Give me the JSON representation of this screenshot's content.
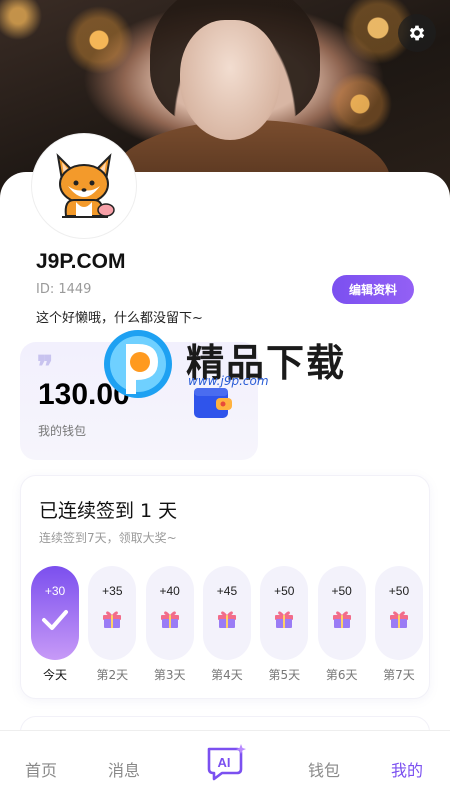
{
  "profile": {
    "username": "J9P.COM",
    "id_text": "ID: 1449",
    "bio": "这个好懒哦，什么都没留下~",
    "edit_label": "编辑资料"
  },
  "wallet": {
    "amount": "130.00",
    "label": "我的钱包"
  },
  "watermark": {
    "text": "精品下载",
    "url": "www.j9p.com"
  },
  "signin": {
    "title": "已连续签到 1 天",
    "subtitle": "连续签到7天，领取大奖~",
    "days": [
      {
        "points": "+30",
        "label": "今天",
        "checked": true
      },
      {
        "points": "+35",
        "label": "第2天",
        "checked": false
      },
      {
        "points": "+40",
        "label": "第3天",
        "checked": false
      },
      {
        "points": "+45",
        "label": "第4天",
        "checked": false
      },
      {
        "points": "+50",
        "label": "第5天",
        "checked": false
      },
      {
        "points": "+50",
        "label": "第6天",
        "checked": false
      },
      {
        "points": "+50",
        "label": "第7天",
        "checked": false
      }
    ]
  },
  "tabs": {
    "home": "首页",
    "messages": "消息",
    "ai": "AI",
    "wallet": "钱包",
    "mine": "我的"
  },
  "colors": {
    "accent": "#7b50f0",
    "wallet_icon": "#2f54eb"
  },
  "icons": {
    "settings": "gear-icon",
    "wallet": "wallet-icon",
    "gift": "gift-icon",
    "check": "check-icon",
    "ai": "ai-chat-icon"
  }
}
